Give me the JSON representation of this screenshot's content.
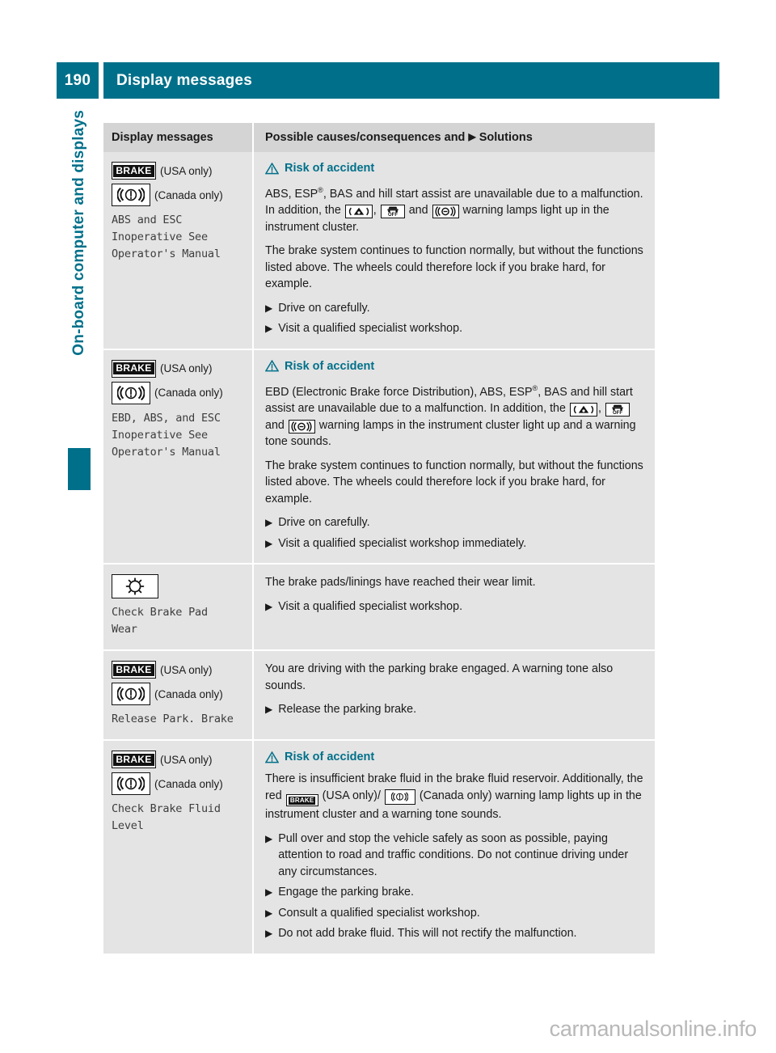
{
  "header": {
    "page_number": "190",
    "title": "Display messages",
    "accent_color": "#00708a"
  },
  "sidebar": {
    "chapter_label": "On-board computer and displays"
  },
  "table": {
    "columns": {
      "left": "Display messages",
      "right_before": "Possible causes/consequences and",
      "right_mark": "▶",
      "right_after": "Solutions"
    },
    "rows": [
      {
        "icons": [
          {
            "type": "brake-lamp",
            "label": "BRAKE",
            "caption": "(USA only)"
          },
          {
            "type": "canada-lamp",
            "caption": "(Canada only)"
          }
        ],
        "message": "ABS and ESC\nInoperative See\nOperator's Manual",
        "warning": "Risk of accident",
        "paragraphs": [
          {
            "segments": [
              {
                "t": "text",
                "v": "ABS, ESP"
              },
              {
                "t": "sup",
                "v": "®"
              },
              {
                "t": "text",
                "v": ", BAS and hill start assist are unavailable due to a malfunction. In addition, the "
              },
              {
                "t": "icon",
                "v": "abs-lamp"
              },
              {
                "t": "text",
                "v": ", "
              },
              {
                "t": "icon",
                "v": "esp-off-lamp"
              },
              {
                "t": "text",
                "v": " and "
              },
              {
                "t": "icon",
                "v": "bas-lamp"
              },
              {
                "t": "text",
                "v": " warning lamps light up in the instrument cluster."
              }
            ]
          },
          {
            "segments": [
              {
                "t": "text",
                "v": "The brake system continues to function normally, but without the functions listed above. The wheels could therefore lock if you brake hard, for example."
              }
            ]
          }
        ],
        "bullets": [
          "Drive on carefully.",
          "Visit a qualified specialist workshop."
        ]
      },
      {
        "icons": [
          {
            "type": "brake-lamp",
            "label": "BRAKE",
            "caption": "(USA only)"
          },
          {
            "type": "canada-lamp",
            "caption": "(Canada only)"
          }
        ],
        "message": "EBD, ABS, and ESC\nInoperative See\nOperator's Manual",
        "warning": "Risk of accident",
        "paragraphs": [
          {
            "segments": [
              {
                "t": "text",
                "v": "EBD (Electronic Brake force Distribution), ABS, ESP"
              },
              {
                "t": "sup",
                "v": "®"
              },
              {
                "t": "text",
                "v": ", BAS and hill start assist are unavailable due to a malfunction. In addition, the "
              },
              {
                "t": "icon",
                "v": "abs-lamp"
              },
              {
                "t": "text",
                "v": ", "
              },
              {
                "t": "icon",
                "v": "esp-off-lamp"
              },
              {
                "t": "text",
                "v": " and "
              },
              {
                "t": "icon",
                "v": "bas-lamp"
              },
              {
                "t": "text",
                "v": " warning lamps in the instrument cluster light up and a warning tone sounds."
              }
            ]
          },
          {
            "segments": [
              {
                "t": "text",
                "v": "The brake system continues to function normally, but without the functions listed above. The wheels could therefore lock if you brake hard, for example."
              }
            ]
          }
        ],
        "bullets": [
          "Drive on carefully.",
          "Visit a qualified specialist workshop immediately."
        ]
      },
      {
        "icons": [
          {
            "type": "disc-lamp"
          }
        ],
        "message": "Check Brake Pad\nWear",
        "warning": null,
        "paragraphs": [
          {
            "segments": [
              {
                "t": "text",
                "v": "The brake pads/linings have reached their wear limit."
              }
            ]
          }
        ],
        "bullets": [
          "Visit a qualified specialist workshop."
        ]
      },
      {
        "icons": [
          {
            "type": "brake-lamp",
            "label": "BRAKE",
            "caption": "(USA only)"
          },
          {
            "type": "canada-lamp",
            "caption": "(Canada only)"
          }
        ],
        "message": "Release Park. Brake",
        "warning": null,
        "paragraphs": [
          {
            "segments": [
              {
                "t": "text",
                "v": "You are driving with the parking brake engaged. A warning tone also sounds."
              }
            ]
          }
        ],
        "bullets": [
          "Release the parking brake."
        ]
      },
      {
        "icons": [
          {
            "type": "brake-lamp",
            "label": "BRAKE",
            "caption": "(USA only)"
          },
          {
            "type": "canada-lamp",
            "caption": "(Canada only)"
          }
        ],
        "message": "Check Brake Fluid\nLevel",
        "warning": "Risk of accident",
        "paragraphs": [
          {
            "segments": [
              {
                "t": "text",
                "v": "There is insufficient brake fluid in the brake fluid reservoir. Additionally, the red "
              },
              {
                "t": "icon",
                "v": "brake-lamp-small"
              },
              {
                "t": "text",
                "v": " (USA only)/ "
              },
              {
                "t": "icon",
                "v": "canada-lamp-small"
              },
              {
                "t": "text",
                "v": " (Canada only) warning lamp lights up in the instrument cluster and a warning tone sounds."
              }
            ]
          }
        ],
        "bullets": [
          "Pull over and stop the vehicle safely as soon as possible, paying attention to road and traffic conditions. Do not continue driving under any circumstances.",
          "Engage the parking brake.",
          "Consult a qualified specialist workshop.",
          "Do not add brake fluid. This will not rectify the malfunction."
        ]
      }
    ]
  },
  "watermark": "carmanualsonline.info"
}
